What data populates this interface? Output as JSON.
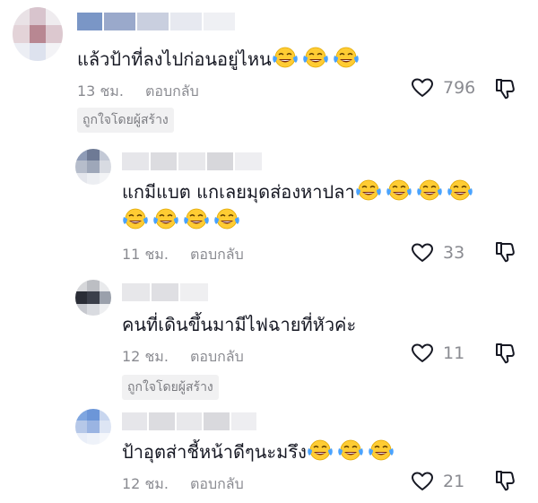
{
  "comments": [
    {
      "text": "แล้วป้าที่ลงไปก่อนอยู่ไหน",
      "emojis": 3,
      "time": "13 ชม.",
      "reply": "ตอบกลับ",
      "likes": "796",
      "badge": "ถูกใจโดยผู้สร้าง"
    },
    {
      "text_line1": "แกมีแบต แกเลยมุดส่องหาปลา",
      "emojis_line1": 4,
      "emojis_line2": 4,
      "time": "11 ชม.",
      "reply": "ตอบกลับ",
      "likes": "33"
    },
    {
      "text": "คนที่เดินขึ้นมามีไฟฉายที่หัวค่ะ",
      "time": "12 ชม.",
      "reply": "ตอบกลับ",
      "likes": "11",
      "badge": "ถูกใจโดยผู้สร้าง"
    },
    {
      "text": "ป้าอุตส่าชี้หน้าดีๆนะมรึง",
      "emojis": 3,
      "time": "12 ชม.",
      "reply": "ตอบกลับ",
      "likes": "21"
    }
  ],
  "icons": {
    "like": "heart-outline-icon",
    "dislike": "thumbs-down-outline-icon",
    "emoji": "face-with-tears-of-joy-emoji"
  },
  "colors": {
    "text": "#161823",
    "secondary": "#8a8b91",
    "badge_bg": "#f1f1f2"
  }
}
